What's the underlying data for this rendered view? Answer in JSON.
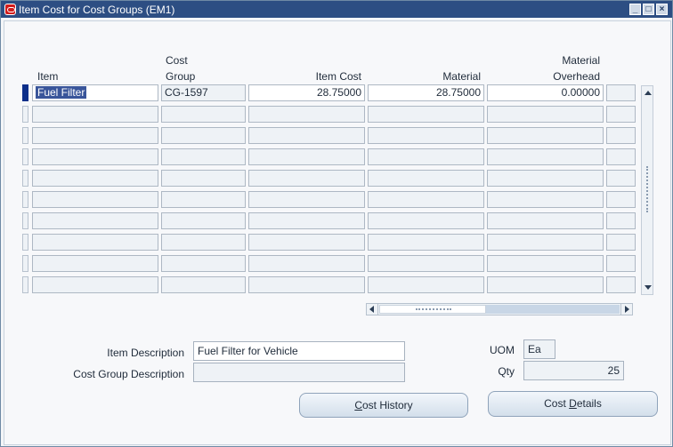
{
  "window": {
    "title": "Item Cost for Cost Groups (EM1)"
  },
  "table": {
    "headers": {
      "item": "Item",
      "cost_group_line1": "Cost",
      "cost_group_line2": "Group",
      "item_cost": "Item Cost",
      "material": "Material",
      "material_overhead_line1": "Material",
      "material_overhead_line2": "Overhead"
    },
    "rows": [
      {
        "item": "Fuel Filter",
        "cost_group": "CG-1597",
        "item_cost": "28.75000",
        "material": "28.75000",
        "material_overhead": "0.00000"
      }
    ],
    "empty_rows": 9
  },
  "details": {
    "item_description_label": "Item Description",
    "item_description_value": "Fuel Filter for Vehicle",
    "cost_group_description_label": "Cost Group Description",
    "cost_group_description_value": "",
    "uom_label": "UOM",
    "uom_value": "Ea",
    "qty_label": "Qty",
    "qty_value": "25"
  },
  "buttons": {
    "cost_history_prefix": "",
    "cost_history_underlined": "C",
    "cost_history_suffix": "ost History",
    "cost_details_prefix": "Cost ",
    "cost_details_underlined": "D",
    "cost_details_suffix": "etails"
  },
  "icons": [
    "oracle-app-icon",
    "minimize-icon",
    "maximize-icon",
    "close-icon",
    "scroll-up-icon",
    "scroll-down-icon",
    "scroll-left-icon",
    "scroll-right-icon"
  ],
  "colors": {
    "titlebar": "#2d4e83",
    "selection": "#39559a",
    "active_row": "#0d2f8a"
  }
}
